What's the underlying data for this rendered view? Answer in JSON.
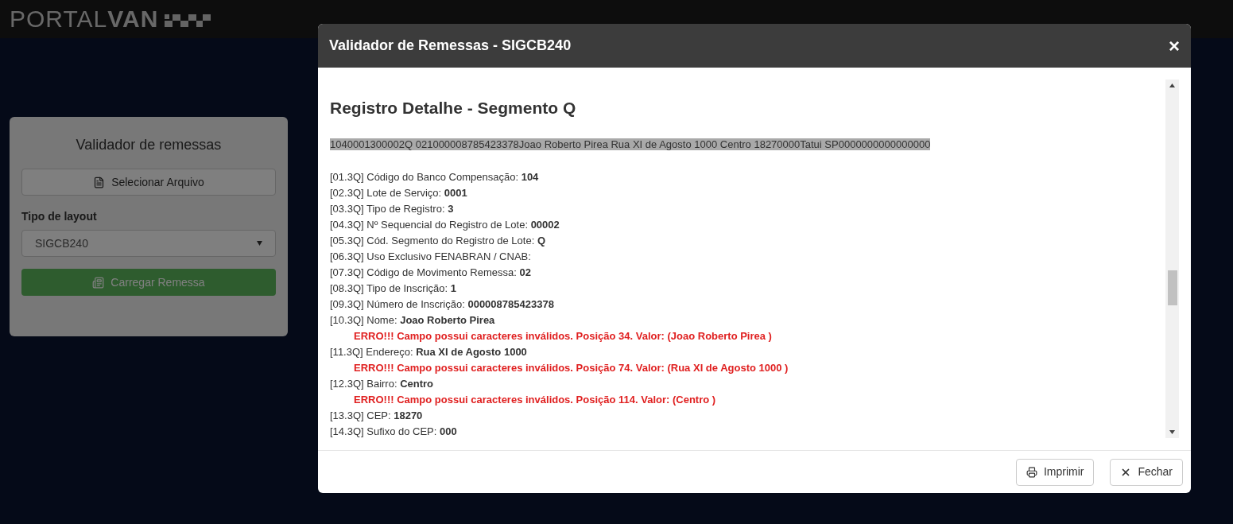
{
  "header": {
    "logo_light": "PORTAL",
    "logo_bold": "VAN"
  },
  "card": {
    "title": "Validador de remessas",
    "file_button": "Selecionar Arquivo",
    "layout_label": "Tipo de layout",
    "layout_value": "SIGCB240",
    "load_button": "Carregar Remessa"
  },
  "modal": {
    "title": "Validador de Remessas - SIGCB240",
    "close": "×",
    "section_title": "Registro Detalhe - Segmento Q",
    "raw_line": "1040001300002Q 021000008785423378Joao Roberto Pirea Rua XI de Agosto 1000 Centro 18270000Tatui SP0000000000000000",
    "fields": [
      {
        "line": "[01.3Q] Código do Banco Compensação: **104**"
      },
      {
        "line": "[02.3Q] Lote de Serviço: **0001**"
      },
      {
        "line": "[03.3Q] Tipo de Registro: **3**"
      },
      {
        "line": "[04.3Q] Nº Sequencial do Registro de Lote: **00002**"
      },
      {
        "line": "[05.3Q] Cód. Segmento do Registro de Lote: **Q**"
      },
      {
        "line": "[06.3Q] Uso Exclusivo FENABRAN / CNAB:"
      },
      {
        "line": "[07.3Q] Código de Movimento Remessa: **02**"
      },
      {
        "line": "[08.3Q] Tipo de Inscrição: **1**"
      },
      {
        "line": "[09.3Q] Número de Inscrição: **000008785423378**"
      },
      {
        "line": "[10.3Q] Nome: **Joao Roberto Pirea**",
        "error": "ERRO!!! Campo possui caracteres inválidos. Posição 34. Valor: (Joao Roberto Pirea )"
      },
      {
        "line": "[11.3Q] Endereço: **Rua XI de Agosto 1000**",
        "error": "ERRO!!! Campo possui caracteres inválidos. Posição 74. Valor: (Rua XI de Agosto 1000 )"
      },
      {
        "line": "[12.3Q] Bairro: **Centro**",
        "error": "ERRO!!! Campo possui caracteres inválidos. Posição 114. Valor: (Centro )"
      },
      {
        "line": "[13.3Q] CEP: **18270**"
      },
      {
        "line": "[14.3Q] Sufixo do CEP: **000**"
      }
    ],
    "print_button": "Imprimir",
    "close_button": "Fechar"
  }
}
